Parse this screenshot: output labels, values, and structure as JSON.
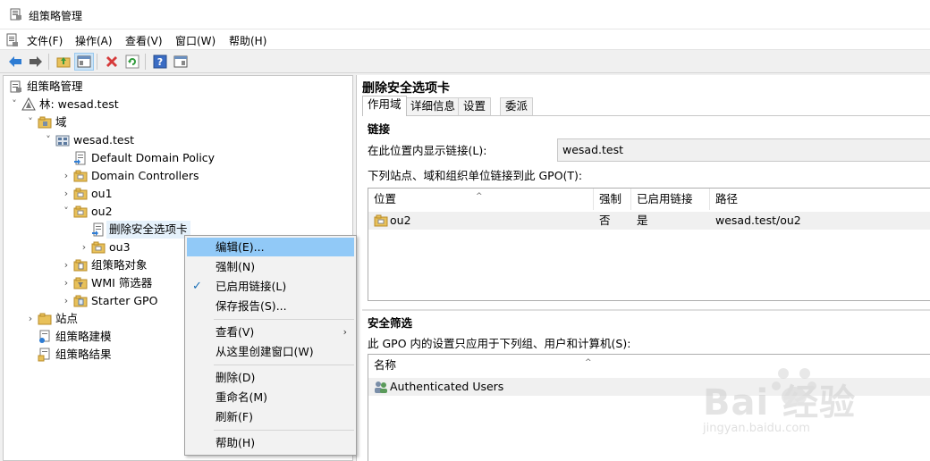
{
  "window": {
    "title": "组策略管理"
  },
  "menu": [
    "文件(F)",
    "操作(A)",
    "查看(V)",
    "窗口(W)",
    "帮助(H)"
  ],
  "toolbar": {
    "icons": [
      "back-icon",
      "forward-icon",
      "up-folder-icon",
      "show-hide-tree-icon",
      "delete-icon",
      "refresh-icon",
      "help-icon",
      "properties-pane-icon"
    ]
  },
  "tree": {
    "root": "组策略管理",
    "forest": "林: wesad.test",
    "domains": "域",
    "domain": "wesad.test",
    "items": [
      "Default Domain Policy",
      "Domain Controllers",
      "ou1",
      "ou2"
    ],
    "selected": "删除安全选项卡",
    "ou3": "ou3",
    "gpo_objects": "组策略对象",
    "wmi": "WMI 筛选器",
    "starter": "Starter GPO",
    "sites": "站点",
    "modeling": "组策略建模",
    "results": "组策略结果"
  },
  "context_menu": {
    "edit": "编辑(E)...",
    "enforce": "强制(N)",
    "link_enabled": "已启用链接(L)",
    "save_report": "保存报告(S)...",
    "view": "查看(V)",
    "new_window": "从这里创建窗口(W)",
    "delete": "删除(D)",
    "rename": "重命名(M)",
    "refresh": "刷新(F)",
    "help": "帮助(H)"
  },
  "details": {
    "title": "删除安全选项卡",
    "tabs": [
      "作用域",
      "详细信息",
      "设置",
      "委派"
    ],
    "links_heading": "链接",
    "display_links_label": "在此位置内显示链接(L):",
    "display_links_value": "wesad.test",
    "linked_desc": "下列站点、域和组织单位链接到此 GPO(T):",
    "links_columns": [
      "位置",
      "强制",
      "已启用链接",
      "路径"
    ],
    "links_rows": [
      {
        "location": "ou2",
        "enforced": "否",
        "enabled": "是",
        "path": "wesad.test/ou2"
      }
    ],
    "security_heading": "安全筛选",
    "security_desc": "此 GPO 内的设置只应用于下列组、用户和计算机(S):",
    "security_columns": [
      "名称"
    ],
    "security_rows": [
      "Authenticated Users"
    ]
  },
  "watermark": {
    "brand": "Bai  经验",
    "url": "jingyan.baidu.com"
  }
}
